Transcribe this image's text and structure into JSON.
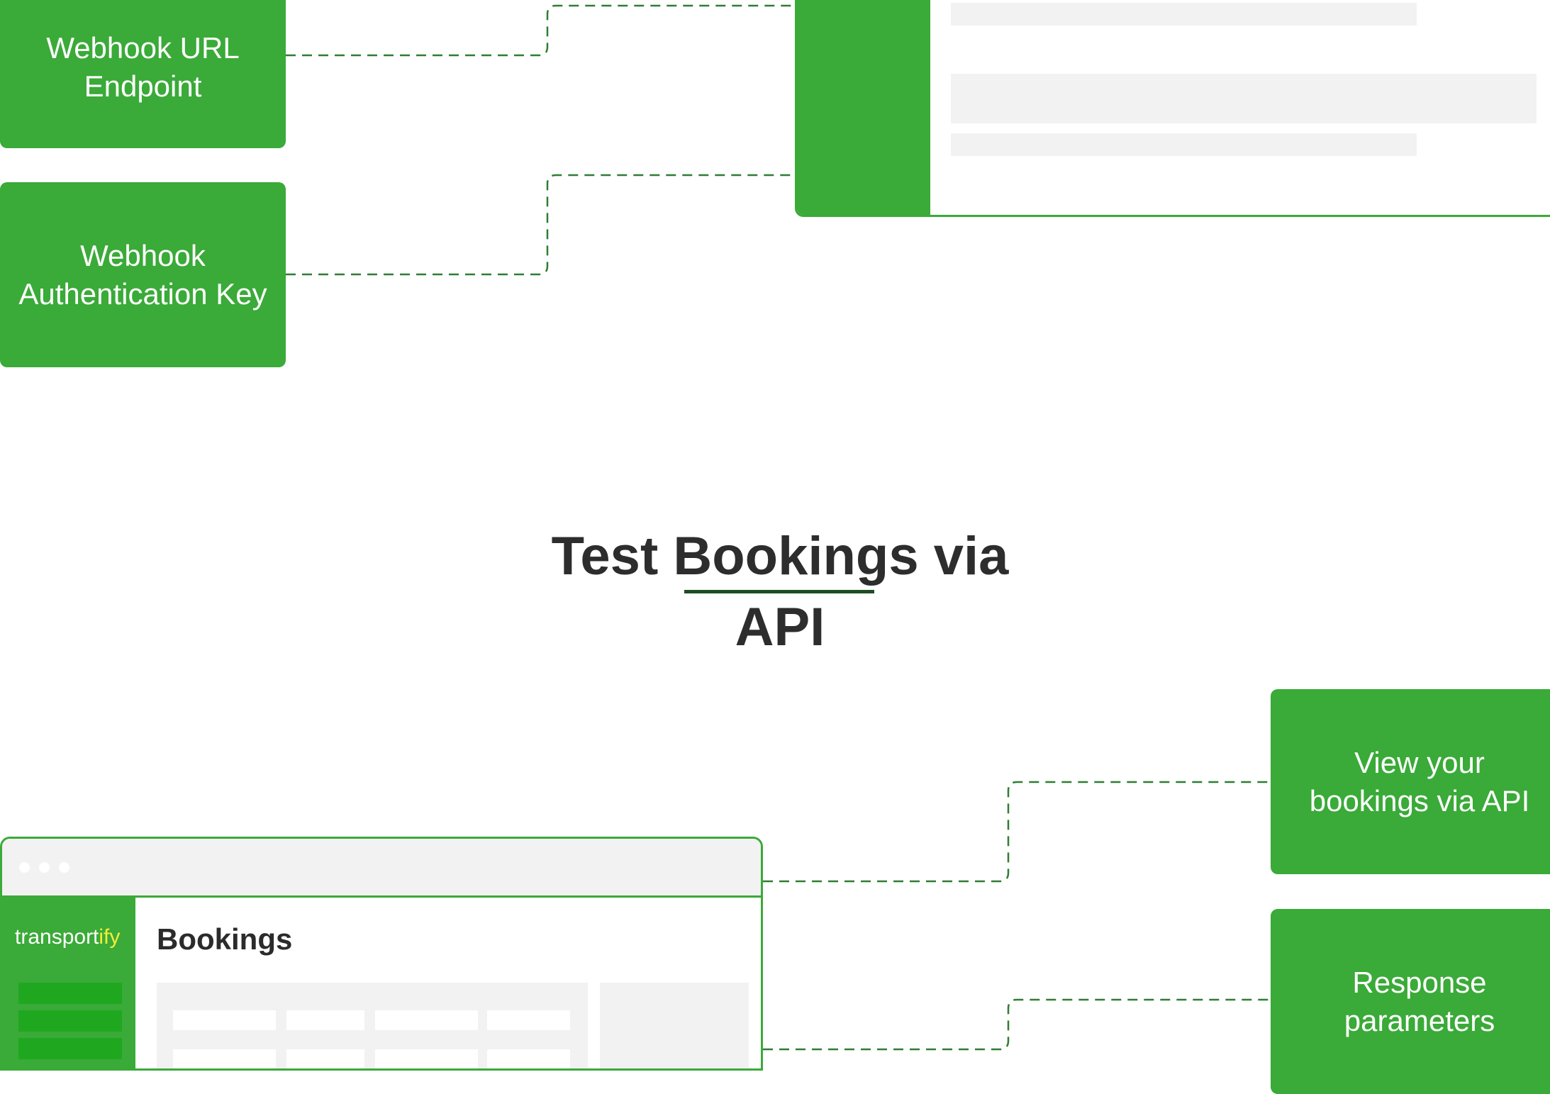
{
  "heading": {
    "line1": "Test Bookings via",
    "line2": "API"
  },
  "boxes": {
    "webhook_url": {
      "line1": "Webhook URL",
      "line2": "Endpoint"
    },
    "webhook_key": {
      "line1": "Webhook",
      "line2": "Authentication Key"
    },
    "view_bookings": {
      "line1": "View your",
      "line2": "bookings via API"
    },
    "response_params": {
      "line1": "Response",
      "line2": "parameters"
    }
  },
  "app_mockup": {
    "logo_main": "transport",
    "logo_accent": "ify",
    "page_title": "Bookings"
  },
  "colors": {
    "green": "#3aaa38",
    "dark_green_line": "#1e4d24",
    "placeholder_gray": "#f2f2f2",
    "text_dark": "#2d2d2d",
    "logo_yellow": "#f2ee3b"
  }
}
